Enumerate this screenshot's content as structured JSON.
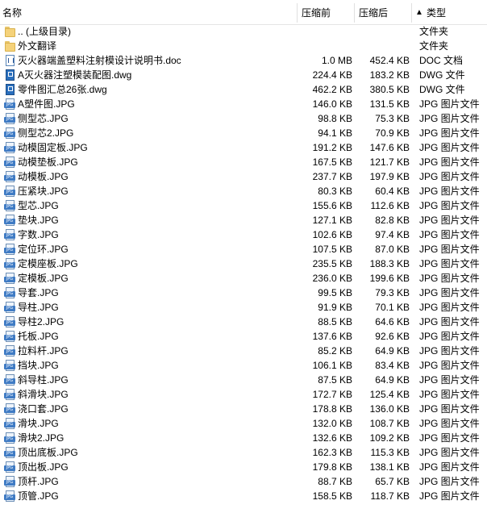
{
  "header": {
    "name": "名称",
    "original": "压缩前",
    "compressed": "压缩后",
    "sort_arrow": "▲",
    "type": "类型"
  },
  "rows": [
    {
      "name": ".. (上级目录)",
      "orig": "",
      "comp": "",
      "type": "文件夹",
      "icon": "folder"
    },
    {
      "name": "外文翻译",
      "orig": "",
      "comp": "",
      "type": "文件夹",
      "icon": "folder"
    },
    {
      "name": "灭火器端盖塑料注射模设计说明书.doc",
      "orig": "1.0 MB",
      "comp": "452.4 KB",
      "type": "DOC 文档",
      "icon": "doc"
    },
    {
      "name": "A灭火器注塑模装配图.dwg",
      "orig": "224.4 KB",
      "comp": "183.2 KB",
      "type": "DWG 文件",
      "icon": "dwg"
    },
    {
      "name": "零件图汇总26张.dwg",
      "orig": "462.2 KB",
      "comp": "380.5 KB",
      "type": "DWG 文件",
      "icon": "dwg"
    },
    {
      "name": "A塑件图.JPG",
      "orig": "146.0 KB",
      "comp": "131.5 KB",
      "type": "JPG 图片文件",
      "icon": "jpg"
    },
    {
      "name": "侧型芯.JPG",
      "orig": "98.8 KB",
      "comp": "75.3 KB",
      "type": "JPG 图片文件",
      "icon": "jpg"
    },
    {
      "name": "侧型芯2.JPG",
      "orig": "94.1 KB",
      "comp": "70.9 KB",
      "type": "JPG 图片文件",
      "icon": "jpg"
    },
    {
      "name": "动模固定板.JPG",
      "orig": "191.2 KB",
      "comp": "147.6 KB",
      "type": "JPG 图片文件",
      "icon": "jpg"
    },
    {
      "name": "动模垫板.JPG",
      "orig": "167.5 KB",
      "comp": "121.7 KB",
      "type": "JPG 图片文件",
      "icon": "jpg"
    },
    {
      "name": "动模板.JPG",
      "orig": "237.7 KB",
      "comp": "197.9 KB",
      "type": "JPG 图片文件",
      "icon": "jpg"
    },
    {
      "name": "压紧块.JPG",
      "orig": "80.3 KB",
      "comp": "60.4 KB",
      "type": "JPG 图片文件",
      "icon": "jpg"
    },
    {
      "name": "型芯.JPG",
      "orig": "155.6 KB",
      "comp": "112.6 KB",
      "type": "JPG 图片文件",
      "icon": "jpg"
    },
    {
      "name": "垫块.JPG",
      "orig": "127.1 KB",
      "comp": "82.8 KB",
      "type": "JPG 图片文件",
      "icon": "jpg"
    },
    {
      "name": "字数.JPG",
      "orig": "102.6 KB",
      "comp": "97.4 KB",
      "type": "JPG 图片文件",
      "icon": "jpg"
    },
    {
      "name": "定位环.JPG",
      "orig": "107.5 KB",
      "comp": "87.0 KB",
      "type": "JPG 图片文件",
      "icon": "jpg"
    },
    {
      "name": "定模座板.JPG",
      "orig": "235.5 KB",
      "comp": "188.3 KB",
      "type": "JPG 图片文件",
      "icon": "jpg"
    },
    {
      "name": "定模板.JPG",
      "orig": "236.0 KB",
      "comp": "199.6 KB",
      "type": "JPG 图片文件",
      "icon": "jpg"
    },
    {
      "name": "导套.JPG",
      "orig": "99.5 KB",
      "comp": "79.3 KB",
      "type": "JPG 图片文件",
      "icon": "jpg"
    },
    {
      "name": "导柱.JPG",
      "orig": "91.9 KB",
      "comp": "70.1 KB",
      "type": "JPG 图片文件",
      "icon": "jpg"
    },
    {
      "name": "导柱2.JPG",
      "orig": "88.5 KB",
      "comp": "64.6 KB",
      "type": "JPG 图片文件",
      "icon": "jpg"
    },
    {
      "name": "托板.JPG",
      "orig": "137.6 KB",
      "comp": "92.6 KB",
      "type": "JPG 图片文件",
      "icon": "jpg"
    },
    {
      "name": "拉料杆.JPG",
      "orig": "85.2 KB",
      "comp": "64.9 KB",
      "type": "JPG 图片文件",
      "icon": "jpg"
    },
    {
      "name": "挡块.JPG",
      "orig": "106.1 KB",
      "comp": "83.4 KB",
      "type": "JPG 图片文件",
      "icon": "jpg"
    },
    {
      "name": "斜导柱.JPG",
      "orig": "87.5 KB",
      "comp": "64.9 KB",
      "type": "JPG 图片文件",
      "icon": "jpg"
    },
    {
      "name": "斜滑块.JPG",
      "orig": "172.7 KB",
      "comp": "125.4 KB",
      "type": "JPG 图片文件",
      "icon": "jpg"
    },
    {
      "name": "浇口套.JPG",
      "orig": "178.8 KB",
      "comp": "136.0 KB",
      "type": "JPG 图片文件",
      "icon": "jpg"
    },
    {
      "name": "滑块.JPG",
      "orig": "132.0 KB",
      "comp": "108.7 KB",
      "type": "JPG 图片文件",
      "icon": "jpg"
    },
    {
      "name": "滑块2.JPG",
      "orig": "132.6 KB",
      "comp": "109.2 KB",
      "type": "JPG 图片文件",
      "icon": "jpg"
    },
    {
      "name": "顶出底板.JPG",
      "orig": "162.3 KB",
      "comp": "115.3 KB",
      "type": "JPG 图片文件",
      "icon": "jpg"
    },
    {
      "name": "顶出板.JPG",
      "orig": "179.8 KB",
      "comp": "138.1 KB",
      "type": "JPG 图片文件",
      "icon": "jpg"
    },
    {
      "name": "顶杆.JPG",
      "orig": "88.7 KB",
      "comp": "65.7 KB",
      "type": "JPG 图片文件",
      "icon": "jpg"
    },
    {
      "name": "顶管.JPG",
      "orig": "158.5 KB",
      "comp": "118.7 KB",
      "type": "JPG 图片文件",
      "icon": "jpg"
    }
  ]
}
